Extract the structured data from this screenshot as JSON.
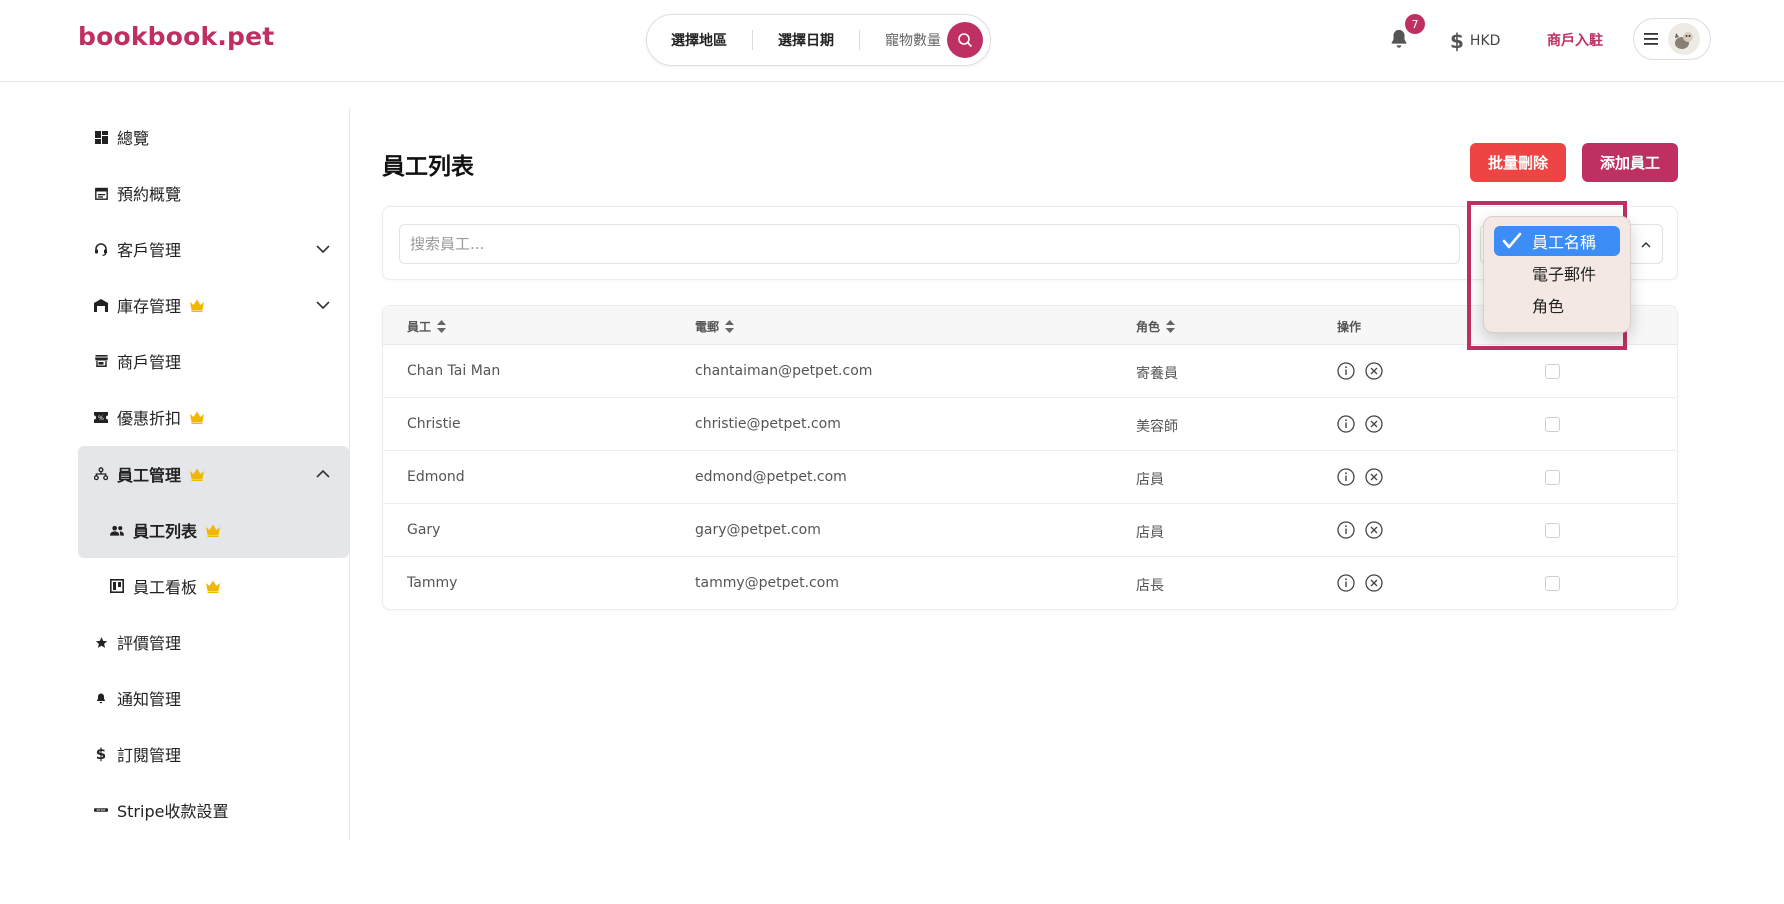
{
  "header": {
    "logo": "bookbook.pet",
    "search": {
      "region": "選擇地區",
      "date": "選擇日期",
      "pets": "寵物數量"
    },
    "notifications_count": "7",
    "currency": "HKD",
    "merchant_link": "商戶入駐",
    "brand_color": "#be2f63"
  },
  "sidebar": {
    "items": [
      {
        "label": "總覽",
        "icon": "dashboard-icon"
      },
      {
        "label": "預約概覽",
        "icon": "calendar-icon"
      },
      {
        "label": "客戶管理",
        "icon": "headset-icon"
      },
      {
        "label": "庫存管理",
        "icon": "warehouse-icon"
      },
      {
        "label": "商戶管理",
        "icon": "store-icon"
      },
      {
        "label": "優惠折扣",
        "icon": "ticket-icon"
      },
      {
        "label": "員工管理",
        "icon": "org-chart-icon"
      },
      {
        "label": "員工列表",
        "icon": "people-icon"
      },
      {
        "label": "員工看板",
        "icon": "board-icon"
      },
      {
        "label": "評價管理",
        "icon": "star-icon"
      },
      {
        "label": "通知管理",
        "icon": "bell-icon"
      },
      {
        "label": "訂閱管理",
        "icon": "dollar-icon"
      },
      {
        "label": "Stripe收款設置",
        "icon": "stripe-icon"
      }
    ]
  },
  "main": {
    "title": "員工列表",
    "bulk_delete_label": "批量刪除",
    "add_staff_label": "添加員工",
    "search_placeholder": "搜索員工...",
    "columns": {
      "staff": "員工",
      "email": "電郵",
      "role": "角色",
      "actions": "操作"
    },
    "rows": [
      {
        "name": "Chan Tai Man",
        "email": "chantaiman@petpet.com",
        "role": "寄養員"
      },
      {
        "name": "Christie",
        "email": "christie@petpet.com",
        "role": "美容師"
      },
      {
        "name": "Edmond",
        "email": "edmond@petpet.com",
        "role": "店員"
      },
      {
        "name": "Gary",
        "email": "gary@petpet.com",
        "role": "店員"
      },
      {
        "name": "Tammy",
        "email": "tammy@petpet.com",
        "role": "店長"
      }
    ]
  },
  "dropdown": {
    "options": [
      {
        "label": "員工名稱",
        "selected": true
      },
      {
        "label": "電子郵件",
        "selected": false
      },
      {
        "label": "角色",
        "selected": false
      }
    ],
    "selected_color": "#3c8ef6"
  }
}
